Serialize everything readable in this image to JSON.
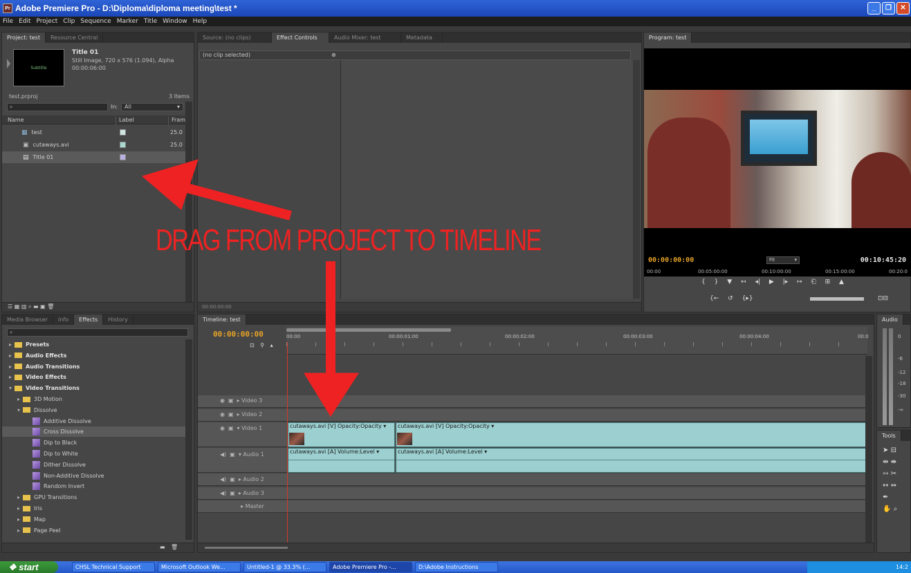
{
  "window": {
    "title": "Adobe Premiere Pro - D:\\Diploma\\diploma meeting\\test *",
    "app_icon": "Pr"
  },
  "menu": [
    "File",
    "Edit",
    "Project",
    "Clip",
    "Sequence",
    "Marker",
    "Title",
    "Window",
    "Help"
  ],
  "project_panel": {
    "tabs": [
      "Project: test",
      "Resource Central"
    ],
    "preview": {
      "name": "Title 01",
      "info": "Still Image, 720 x 576 (1.094), Alpha",
      "duration": "00:00:06:00",
      "thumb_text": "Subtitle"
    },
    "file": "test.prproj",
    "count": "3 Items",
    "in_label": "In:",
    "in_value": "All",
    "columns": [
      "Name",
      "Label",
      "Fram"
    ],
    "items": [
      {
        "name": "test",
        "fps": "25.0",
        "color": "#cfe6e0"
      },
      {
        "name": "cutaways.avi",
        "fps": "25.0",
        "color": "#a8d8d0"
      },
      {
        "name": "Title 01",
        "fps": "",
        "color": "#b8b0e0"
      }
    ]
  },
  "source_panel": {
    "tabs": [
      "Source: (no clips)",
      "Effect Controls",
      "Audio Mixer: test",
      "Metadata"
    ],
    "no_clip": "(no clip selected)",
    "timecode": "00:00:00:00"
  },
  "program_panel": {
    "tab": "Program: test",
    "timecode_left": "00:00:00:00",
    "fit": "Fit",
    "timecode_right": "00:10:45:20",
    "ruler": [
      "00:00",
      "00:05:00:00",
      "00:10:00:00",
      "00:15:00:00",
      "00:20:0"
    ]
  },
  "effects_panel": {
    "tabs": [
      "Media Browser",
      "Info",
      "Effects",
      "History"
    ],
    "items": [
      {
        "label": "Presets",
        "level": 0,
        "type": "preset-folder",
        "open": false
      },
      {
        "label": "Audio Effects",
        "level": 0,
        "type": "folder",
        "open": false
      },
      {
        "label": "Audio Transitions",
        "level": 0,
        "type": "folder",
        "open": false
      },
      {
        "label": "Video Effects",
        "level": 0,
        "type": "folder",
        "open": false
      },
      {
        "label": "Video Transitions",
        "level": 0,
        "type": "folder",
        "open": true
      },
      {
        "label": "3D Motion",
        "level": 1,
        "type": "folder",
        "open": false
      },
      {
        "label": "Dissolve",
        "level": 1,
        "type": "folder",
        "open": true
      },
      {
        "label": "Additive Dissolve",
        "level": 2,
        "type": "effect",
        "selected": false
      },
      {
        "label": "Cross Dissolve",
        "level": 2,
        "type": "effect",
        "selected": true
      },
      {
        "label": "Dip to Black",
        "level": 2,
        "type": "effect",
        "selected": false
      },
      {
        "label": "Dip to White",
        "level": 2,
        "type": "effect",
        "selected": false
      },
      {
        "label": "Dither Dissolve",
        "level": 2,
        "type": "effect",
        "selected": false
      },
      {
        "label": "Non-Additive Dissolve",
        "level": 2,
        "type": "effect",
        "selected": false
      },
      {
        "label": "Random Invert",
        "level": 2,
        "type": "effect",
        "selected": false
      },
      {
        "label": "GPU Transitions",
        "level": 1,
        "type": "folder",
        "open": false
      },
      {
        "label": "Iris",
        "level": 1,
        "type": "folder",
        "open": false
      },
      {
        "label": "Map",
        "level": 1,
        "type": "folder",
        "open": false
      },
      {
        "label": "Page Peel",
        "level": 1,
        "type": "folder",
        "open": false
      }
    ]
  },
  "timeline": {
    "tab": "Timeline: test",
    "timecode": "00:00:00:00",
    "ruler": [
      "00:00",
      "00:00:01:00",
      "00:00:02:00",
      "00:00:03:00",
      "00:00:04:00",
      "00:0"
    ],
    "tracks": [
      "Video 3",
      "Video 2",
      "Video 1",
      "Audio 1",
      "Audio 2",
      "Audio 3",
      "Master"
    ],
    "clips": {
      "v1a": "cutaways.avi [V] Opacity:Opacity ▾",
      "v1b": "cutaways.avi [V] Opacity:Opacity ▾",
      "a1a": "cutaways.avi [A] Volume:Level ▾",
      "a1b": "cutaways.avi [A] Volume:Level ▾"
    }
  },
  "audio_panel": {
    "tab": "Audio",
    "scale": [
      "0",
      "-6",
      "-12",
      "-18",
      "-30",
      "-∞"
    ]
  },
  "tools_panel": {
    "tab": "Tools"
  },
  "overlay": {
    "text": "DRAG FROM PROJECT TO TIMELINE",
    "color": "#ee2222"
  },
  "taskbar": {
    "start": "start",
    "tasks": [
      "CHSL Technical Support",
      "Microsoft Outlook We...",
      "Untitled-1 @ 33.3% (...",
      "Adobe Premiere Pro -...",
      "D:\\Adobe Instructions"
    ],
    "clock": "14:2"
  }
}
